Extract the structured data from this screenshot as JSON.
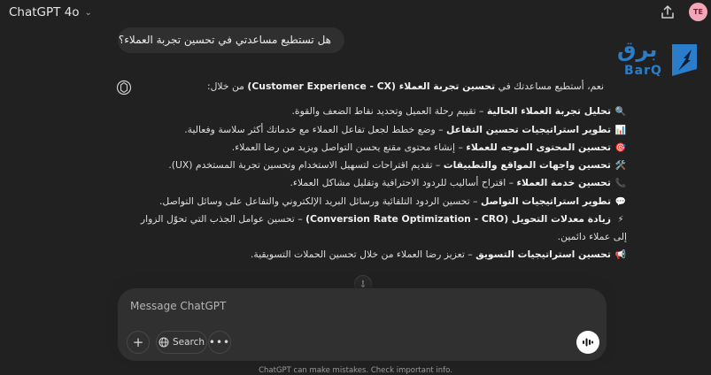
{
  "header": {
    "model_name": "ChatGPT 4o",
    "avatar_initials": "TE"
  },
  "user_message": "هل تستطيع مساعدتي في  تحسين تجربة العملاء؟",
  "logo": {
    "arabic_text": "برق",
    "latin_text": "BarQ",
    "brand_color": "#2a7dc9"
  },
  "assistant": {
    "intro_prefix": "نعم، أستطيع مساعدتك في ",
    "intro_bold": "تحسين تجربة العملاء (Customer Experience - CX)",
    "intro_suffix": " من خلال:",
    "items": [
      {
        "icon": "🔍",
        "title": "تحليل تجربة العملاء الحالية",
        "desc": " – تقييم رحلة العميل وتحديد نقاط الضعف والقوة."
      },
      {
        "icon": "📊",
        "title": "تطوير استراتيجيات تحسين التفاعل",
        "desc": " – وضع خطط لجعل تفاعل العملاء مع خدماتك أكثر سلاسة وفعالية."
      },
      {
        "icon": "🎯",
        "title": "تحسين المحتوى الموجه للعملاء",
        "desc": " – إنشاء محتوى مقنع يحسن التواصل ويزيد من رضا العملاء."
      },
      {
        "icon": "🛠️",
        "title": "تحسين واجهات المواقع والتطبيقات",
        "desc": " – تقديم اقتراحات لتسهيل الاستخدام وتحسين تجربة المستخدم (UX)."
      },
      {
        "icon": "📞",
        "title": "تحسين خدمة العملاء",
        "desc": " – اقتراح أساليب للردود الاحترافية وتقليل مشاكل العملاء."
      },
      {
        "icon": "💬",
        "title": "تطوير استراتيجيات التواصل",
        "desc": " – تحسين الردود التلقائية ورسائل البريد الإلكتروني والتفاعل على وسائل التواصل."
      },
      {
        "icon": "⚡",
        "title": "زيادة معدلات التحويل (Conversion Rate Optimization - CRO)",
        "desc": " – تحسين عوامل الجذب التي تحوّل الزوار إلى عملاء دائمين."
      },
      {
        "icon": "📢",
        "title": "تحسين استراتيجيات التسويق",
        "desc": " – تعزيز رضا العملاء من خلال تحسين الحملات التسويقية."
      }
    ]
  },
  "composer": {
    "placeholder": "Message ChatGPT",
    "search_label": "Search"
  },
  "footer": {
    "disclaimer": "ChatGPT can make mistakes. Check important info."
  }
}
